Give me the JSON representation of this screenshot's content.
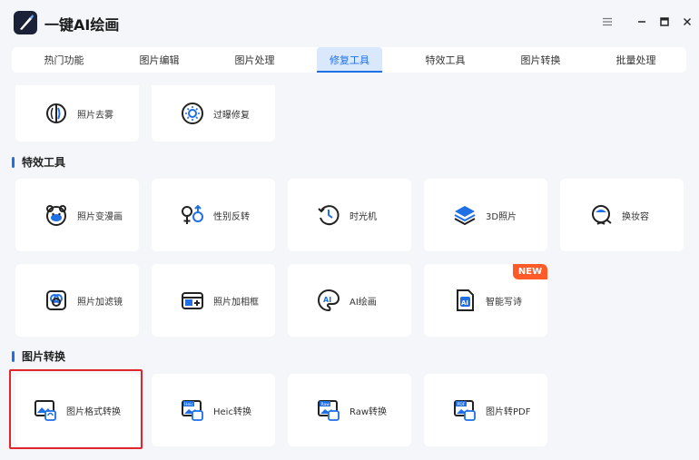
{
  "app": {
    "title": "一键AI绘画"
  },
  "tabs": [
    {
      "label": "热门功能"
    },
    {
      "label": "图片编辑"
    },
    {
      "label": "图片处理"
    },
    {
      "label": "修复工具",
      "active": true
    },
    {
      "label": "特效工具"
    },
    {
      "label": "图片转换"
    },
    {
      "label": "批量处理"
    }
  ],
  "repair_tools": [
    {
      "label": "照片去雾",
      "icon": "dehaze-icon"
    },
    {
      "label": "过曝修复",
      "icon": "overexposure-fix-icon"
    }
  ],
  "sections": {
    "effects": "特效工具",
    "convert": "图片转换"
  },
  "effect_tools": [
    {
      "label": "照片变漫画",
      "icon": "cartoon-face-icon"
    },
    {
      "label": "性别反转",
      "icon": "gender-swap-icon"
    },
    {
      "label": "时光机",
      "icon": "time-machine-icon"
    },
    {
      "label": "3D照片",
      "icon": "3d-layers-icon"
    },
    {
      "label": "换妆容",
      "icon": "makeup-icon"
    },
    {
      "label": "照片加滤镜",
      "icon": "filter-icon"
    },
    {
      "label": "照片加相框",
      "icon": "photo-frame-icon"
    },
    {
      "label": "AI绘画",
      "icon": "ai-paint-icon"
    },
    {
      "label": "智能写诗",
      "icon": "ai-poem-icon",
      "badge": "NEW"
    }
  ],
  "convert_tools": [
    {
      "label": "图片格式转换",
      "icon": "format-convert-icon",
      "highlighted": true
    },
    {
      "label": "Heic转换",
      "icon": "heic-convert-icon",
      "tag": "Heic"
    },
    {
      "label": "Raw转换",
      "icon": "raw-convert-icon",
      "tag": "Raw"
    },
    {
      "label": "图片转PDF",
      "icon": "pdf-convert-icon",
      "tag": "PDF"
    }
  ],
  "colors": {
    "accent": "#1f6fe5",
    "badge": "#ff5a28",
    "highlight": "#e0262b",
    "background": "#f4f6fa"
  }
}
